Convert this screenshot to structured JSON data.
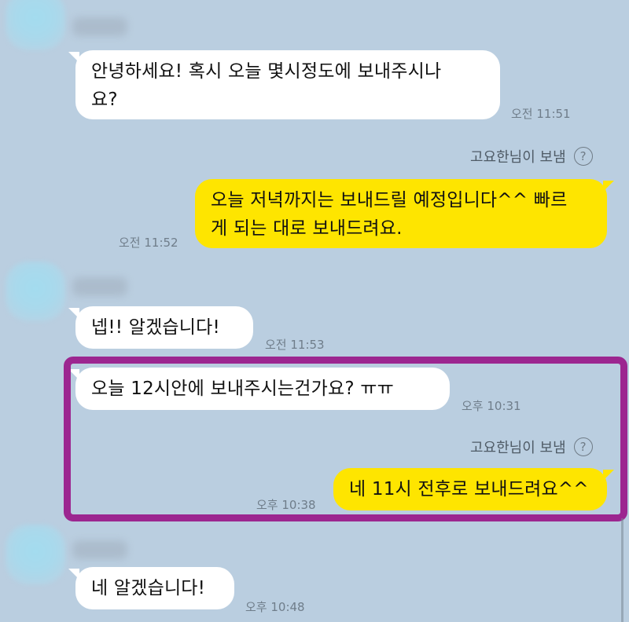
{
  "messages": [
    {
      "id": 1,
      "direction": "in",
      "text_lines": [
        "안녕하세요! 혹시 오늘 몇시정도에 보내주시나",
        "요?"
      ],
      "time": "오전 11:51"
    },
    {
      "id": 2,
      "direction": "out",
      "sent_by": "고요한님이 보냄",
      "text_lines": [
        "오늘 저녁까지는 보내드릴 예정입니다^^ 빠르",
        "게 되는 대로 보내드려요."
      ],
      "time": "오전 11:52"
    },
    {
      "id": 3,
      "direction": "in",
      "text_lines": [
        "넵!! 알겠습니다!"
      ],
      "time": "오전 11:53"
    },
    {
      "id": 4,
      "direction": "in",
      "text_lines": [
        "오늘 12시안에 보내주시는건가요? ㅠㅠ"
      ],
      "time": "오후 10:31"
    },
    {
      "id": 5,
      "direction": "out",
      "sent_by": "고요한님이 보냄",
      "text_lines": [
        "네 11시 전후로 보내드려요^^"
      ],
      "time": "오후 10:38"
    },
    {
      "id": 6,
      "direction": "in",
      "text_lines": [
        "네 알겠습니다!"
      ],
      "time": "오후 10:48"
    }
  ],
  "icons": {
    "help": "question-circle-icon"
  },
  "colors": {
    "background": "#bacee0",
    "incoming_bubble": "#ffffff",
    "outgoing_bubble": "#fee500",
    "highlight_border": "#9c2690"
  }
}
